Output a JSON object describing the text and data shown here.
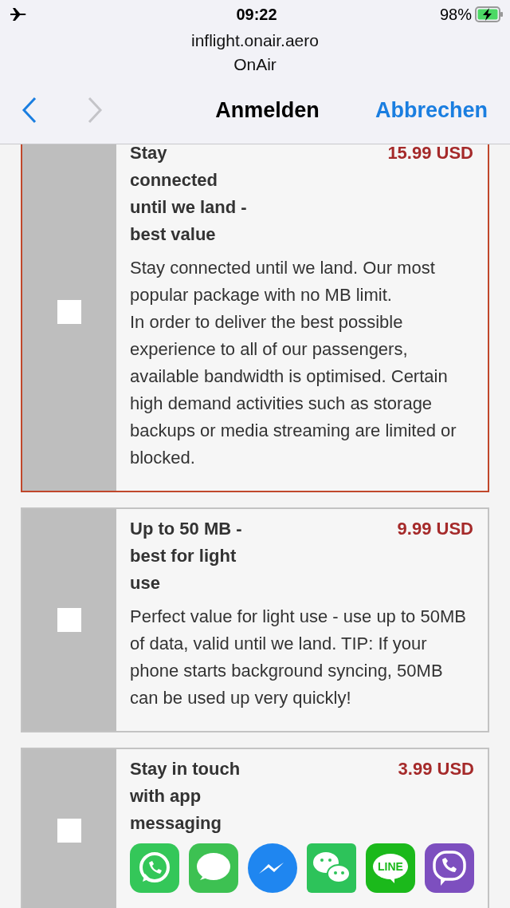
{
  "status_bar": {
    "time": "09:22",
    "battery": "98%"
  },
  "header": {
    "domain": "inflight.onair.aero",
    "site": "OnAir",
    "title": "Anmelden",
    "cancel": "Abbrechen"
  },
  "plans": [
    {
      "title": "Stay\nconnected\nuntil we land -\nbest value",
      "price": "15.99 USD",
      "description": "Stay connected until we land. Our most popular package with no MB limit.\nIn order to deliver the best possible experience to all of our passengers, available bandwidth is optimised. Certain high demand activities such as storage backups or media streaming are limited or blocked.",
      "selected": true,
      "checked": false
    },
    {
      "title": "Up to 50 MB -\nbest for light\nuse",
      "price": "9.99 USD",
      "description": "Perfect value for light use - use up to 50MB of data, valid until we land. TIP: If your phone starts background syncing, 50MB can be used up very quickly!",
      "selected": false,
      "checked": false
    },
    {
      "title": "Stay in touch\nwith app\nmessaging",
      "price": "3.99 USD",
      "selected": false,
      "checked": false,
      "apps": [
        {
          "kind": "phone"
        },
        {
          "kind": "bubble"
        },
        {
          "kind": "bolt"
        },
        {
          "kind": "twin"
        },
        {
          "kind": "lettered",
          "label": "LINE"
        },
        {
          "kind": "ring"
        }
      ]
    }
  ]
}
